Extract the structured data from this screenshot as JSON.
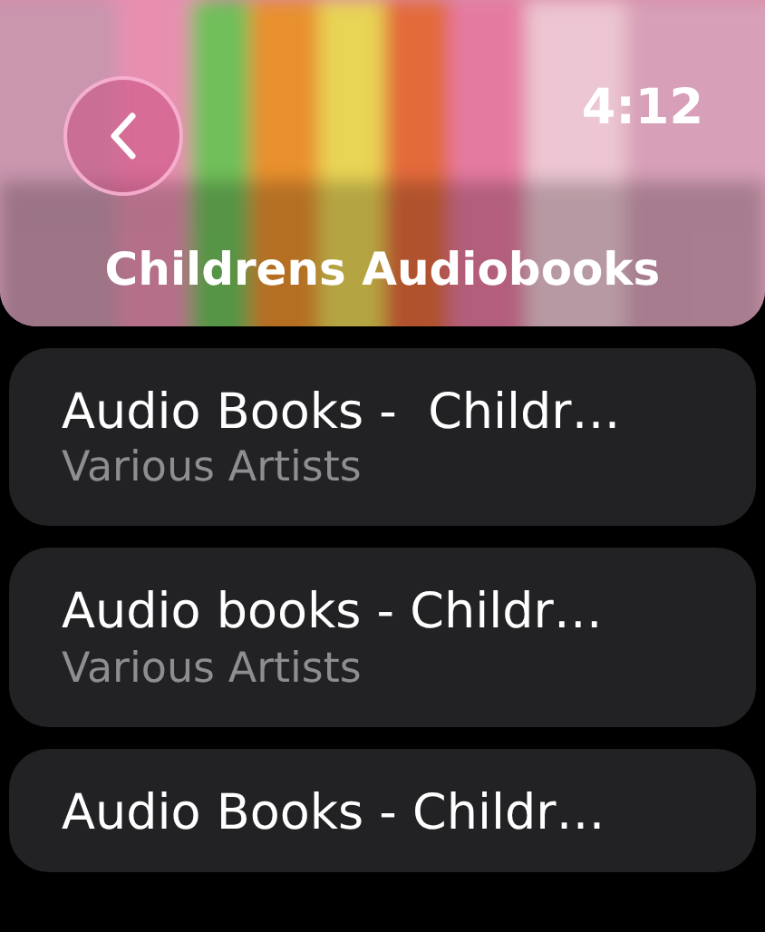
{
  "header": {
    "kind": "picture",
    "time": "4:12",
    "title": "Childrens Audiobooks"
  },
  "items": [
    {
      "title": "Audio Books -  Childr…",
      "subtitle": "Various Artists"
    },
    {
      "title": "Audio books - Childr…",
      "subtitle": "Various Artists"
    },
    {
      "title": "Audio Books - Childr…"
    }
  ]
}
